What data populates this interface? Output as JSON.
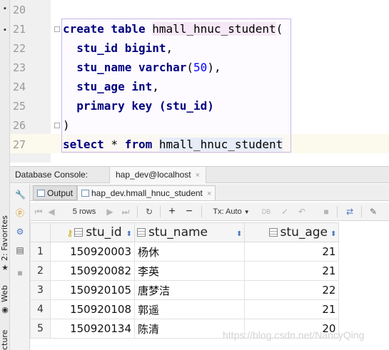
{
  "editor": {
    "lines": [
      {
        "no": "20"
      },
      {
        "no": "21",
        "code": "create table",
        "ident": "hmall_hnuc_student",
        "tail": "("
      },
      {
        "no": "22",
        "col": "stu_id",
        "type": "bigint",
        "tail": ","
      },
      {
        "no": "23",
        "col": "stu_name",
        "type": "varchar",
        "open": "(",
        "num": "50",
        "tail": "),"
      },
      {
        "no": "24",
        "col": "stu_age",
        "type": "int",
        "tail": ","
      },
      {
        "no": "25",
        "code": "primary key",
        "rest": "(stu_id)"
      },
      {
        "no": "26",
        "code": ")"
      },
      {
        "no": "27",
        "code": "select",
        "rest": " * ",
        "from": "from",
        "ident": "hmall_hnuc_student"
      }
    ]
  },
  "console": {
    "label": "Database Console:",
    "tab": "hap_dev@localhost",
    "close": "×"
  },
  "subtabs": {
    "output": "Output",
    "result": "hap_dev.hmall_hnuc_student",
    "close": "×"
  },
  "toolbar": {
    "rows": "5 rows",
    "tx": "Tx: Auto"
  },
  "sidebar": {
    "favorites": "2: Favorites",
    "web": "Web",
    "structure": "cture"
  },
  "grid": {
    "columns": [
      "stu_id",
      "stu_name",
      "stu_age"
    ],
    "rows": [
      {
        "n": "1",
        "stu_id": "150920003",
        "stu_name": "杨休",
        "stu_age": "21"
      },
      {
        "n": "2",
        "stu_id": "150920082",
        "stu_name": "李英",
        "stu_age": "21"
      },
      {
        "n": "3",
        "stu_id": "150920105",
        "stu_name": "唐梦洁",
        "stu_age": "22"
      },
      {
        "n": "4",
        "stu_id": "150920108",
        "stu_name": "郭遥",
        "stu_age": "21"
      },
      {
        "n": "5",
        "stu_id": "150920134",
        "stu_name": "陈清",
        "stu_age": "20"
      }
    ]
  },
  "watermark": "https://blog.csdn.net/NancyQing",
  "colors": {
    "keyword": "#000080",
    "number": "#0000ff",
    "identifier_bg": "#f6e8f6",
    "caret_line": "#fcfaed"
  }
}
